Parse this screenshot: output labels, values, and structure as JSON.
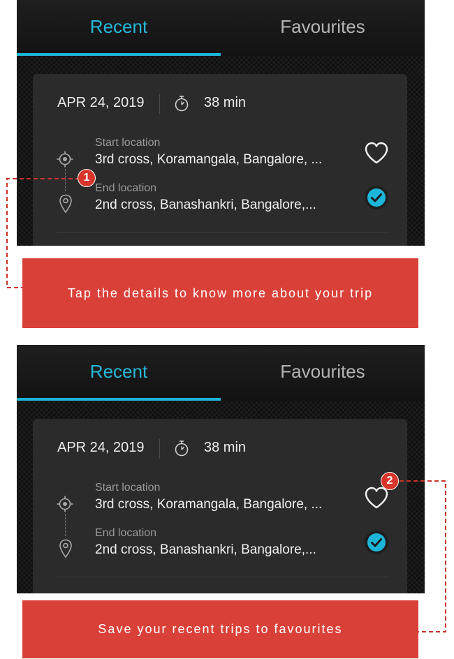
{
  "screens": [
    {
      "tabs": {
        "recent": "Recent",
        "favourites": "Favourites",
        "active": "recent"
      },
      "trip": {
        "date": "APR 24, 2019",
        "duration": "38 min",
        "start_label": "Start location",
        "start_address": "3rd cross, Koramangala, Bangalore, ...",
        "end_label": "End location",
        "end_address": "2nd cross, Banashankri, Bangalore,..."
      },
      "badge": "1",
      "caption": "Tap the details to know more about your trip"
    },
    {
      "tabs": {
        "recent": "Recent",
        "favourites": "Favourites",
        "active": "recent"
      },
      "trip": {
        "date": "APR 24, 2019",
        "duration": "38 min",
        "start_label": "Start location",
        "start_address": "3rd cross, Koramangala, Bangalore, ...",
        "end_label": "End location",
        "end_address": "2nd cross, Banashankri, Bangalore,..."
      },
      "badge": "2",
      "caption": "Save your recent trips to favourites"
    }
  ],
  "icons": {
    "timer": "stopwatch-icon",
    "start": "target-icon",
    "end": "map-pin-icon",
    "favourite": "heart-outline-icon",
    "selected": "check-circle-icon"
  },
  "colors": {
    "accent": "#1bb5d8",
    "callout": "#d94138",
    "badge": "#d8352c",
    "card": "#2b2b2b"
  }
}
